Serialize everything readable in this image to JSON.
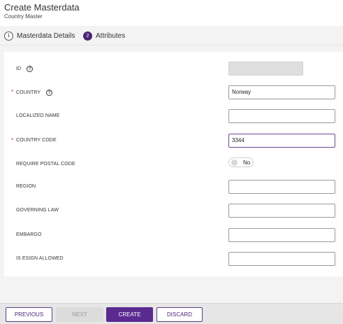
{
  "header": {
    "title": "Create Masterdata",
    "subtitle": "Country Master"
  },
  "steps": [
    {
      "number": "1",
      "label": "Masterdata Details"
    },
    {
      "number": "2",
      "label": "Attributes"
    }
  ],
  "form": {
    "id": {
      "label": "ID",
      "value": ""
    },
    "country": {
      "label": "COUNTRY",
      "value": "Norway",
      "required": "*"
    },
    "localized_name": {
      "label": "LOCALIZED NAME",
      "value": ""
    },
    "country_code": {
      "label": "COUNTRY CODE",
      "value": "3344",
      "required": "*"
    },
    "require_postal_code": {
      "label": "REQUIRE POSTAL CODE",
      "toggle_label": "No"
    },
    "region": {
      "label": "REGION",
      "value": ""
    },
    "governing_law": {
      "label": "GOVERNING LAW",
      "value": ""
    },
    "embargo": {
      "label": "EMBARGO",
      "value": ""
    },
    "is_esign_allowed": {
      "label": "IS ESIGN ALLOWED",
      "value": ""
    }
  },
  "footer": {
    "previous": "PREVIOUS",
    "next": "NEXT",
    "create": "CREATE",
    "discard": "DISCARD"
  },
  "icons": {
    "help": "question-circle-icon"
  },
  "colors": {
    "accent": "#5b2a91",
    "required": "#c0392b"
  }
}
